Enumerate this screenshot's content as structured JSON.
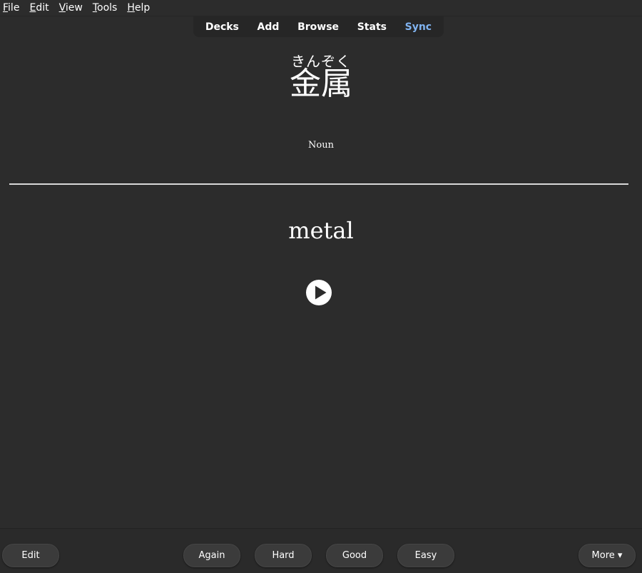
{
  "menubar": {
    "items": [
      {
        "mnemonic": "F",
        "rest": "ile"
      },
      {
        "mnemonic": "E",
        "rest": "dit"
      },
      {
        "mnemonic": "V",
        "rest": "iew"
      },
      {
        "mnemonic": "T",
        "rest": "ools"
      },
      {
        "mnemonic": "H",
        "rest": "elp"
      }
    ]
  },
  "toolbar": {
    "decks": "Decks",
    "add": "Add",
    "browse": "Browse",
    "stats": "Stats",
    "sync": "Sync",
    "sync_color": "#80b3f0"
  },
  "card": {
    "reading": "きんぞく",
    "expression": "金属",
    "part_of_speech": "Noun",
    "meaning": "metal",
    "audio_icon": "play-circle-icon"
  },
  "bottombar": {
    "edit": "Edit",
    "again": "Again",
    "hard": "Hard",
    "good": "Good",
    "easy": "Easy",
    "more": "More ▾"
  }
}
